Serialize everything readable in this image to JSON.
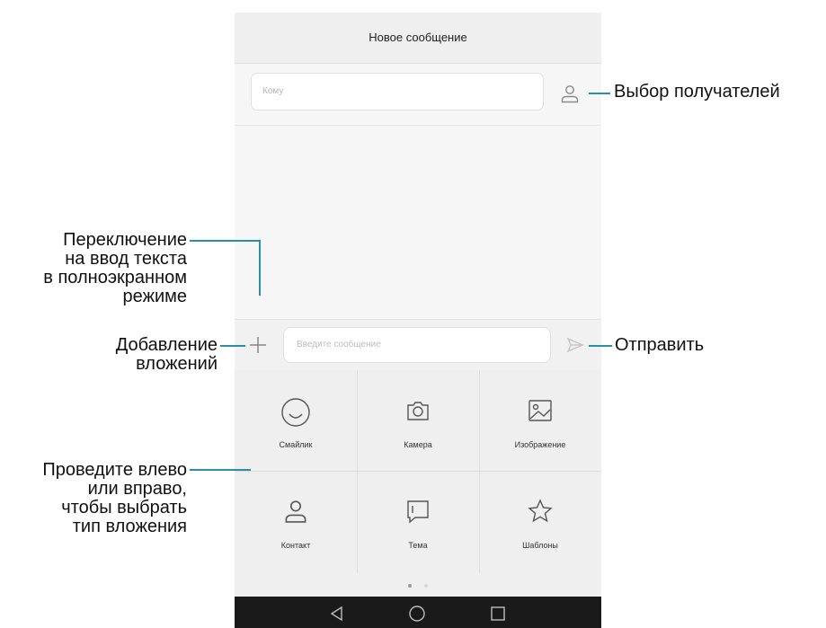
{
  "header": {
    "title": "Новое сообщение"
  },
  "recipient": {
    "placeholder": "Кому",
    "icon": "person-icon"
  },
  "composer": {
    "placeholder": "Введите сообщение",
    "attach_icon": "plus-icon",
    "send_icon": "send-icon"
  },
  "attachments": [
    {
      "label": "Смайлик",
      "icon": "smiley-icon"
    },
    {
      "label": "Камера",
      "icon": "camera-icon"
    },
    {
      "label": "Изображение",
      "icon": "image-icon"
    },
    {
      "label": "Контакт",
      "icon": "person-icon"
    },
    {
      "label": "Тема",
      "icon": "subject-icon"
    },
    {
      "label": "Шаблоны",
      "icon": "star-icon"
    }
  ],
  "pager": {
    "pages": 2,
    "current": 1
  },
  "navigation": {
    "buttons": [
      "back-icon",
      "home-icon",
      "recents-icon"
    ]
  },
  "callouts": {
    "select_recipients": "Выбор получателей",
    "fullscreen_toggle": [
      "Переключение",
      "на ввод текста",
      "в полноэкранном",
      "режиме"
    ],
    "add_attachments": [
      "Добавление",
      "вложений"
    ],
    "send": "Отправить",
    "swipe_hint": [
      "Проведите влево",
      "или вправо,",
      "чтобы выбрать",
      "тип вложения"
    ]
  },
  "colors": {
    "callout_line": "#2b8fa8",
    "nav_bar": "#1a1a1a",
    "background": "#f6f6f6"
  }
}
